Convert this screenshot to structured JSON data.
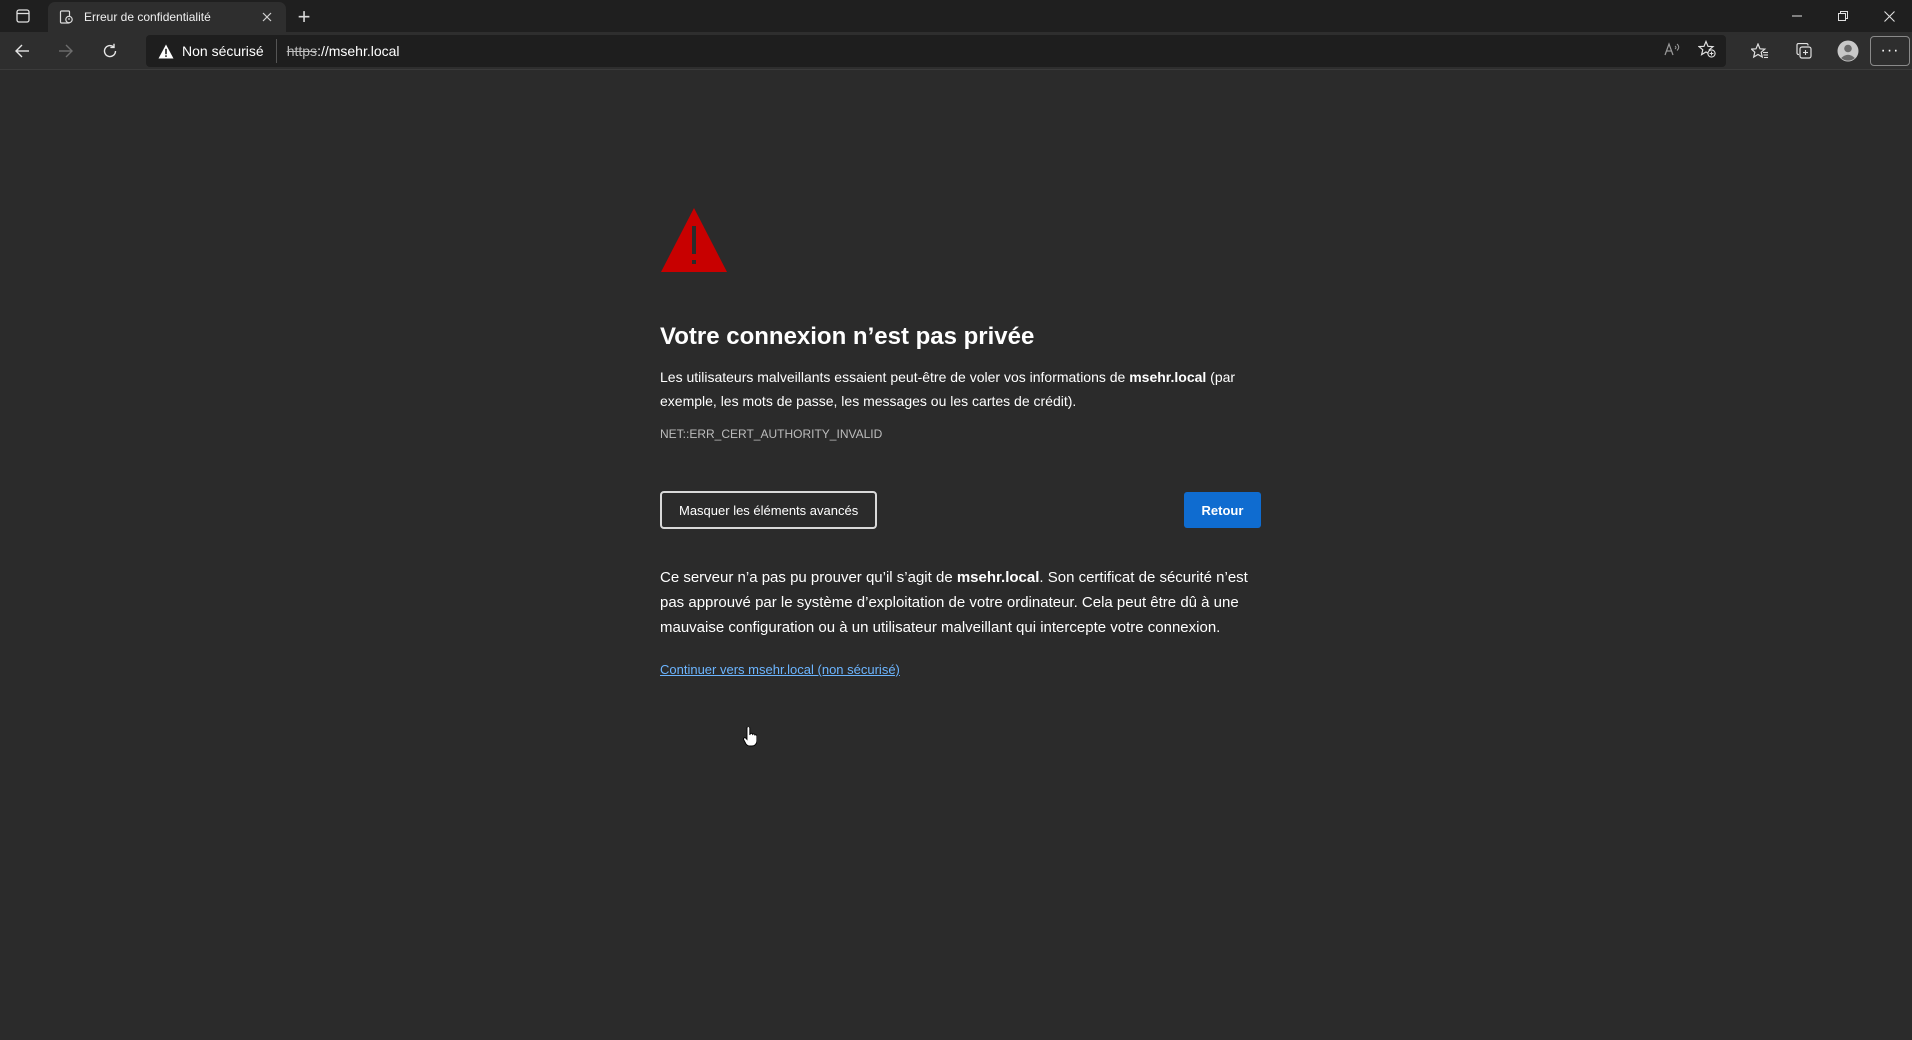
{
  "tab": {
    "title": "Erreur de confidentialité",
    "new_tab_symbol": "+"
  },
  "window_controls": {
    "minimize": "—",
    "restore": "▢",
    "close": "✕"
  },
  "addressbar": {
    "security_label": "Non sécurisé",
    "url_scheme": "https",
    "url_rest": "://msehr.local"
  },
  "toolbar": {
    "more_label": "···"
  },
  "error_page": {
    "heading": "Votre connexion n’est pas privée",
    "desc_before": "Les utilisateurs malveillants essaient peut-être de voler vos informations de ",
    "desc_host": "msehr.local",
    "desc_after": " (par exemple, les mots de passe, les messages ou les cartes de crédit).",
    "error_code": "NET::ERR_CERT_AUTHORITY_INVALID",
    "advanced_button": "Masquer les éléments avancés",
    "back_button": "Retour",
    "details_before": "Ce serveur n’a pas pu prouver qu’il s’agit de ",
    "details_host": "msehr.local",
    "details_after": ". Son certificat de sécurité n’est pas approuvé par le système d’exploitation de votre ordinateur. Cela peut être dû à une mauvaise configuration ou à un utilisateur malveillant qui intercepte votre connexion.",
    "proceed_link": "Continuer vers msehr.local (non sécurisé)"
  },
  "colors": {
    "warning_red": "#c80000",
    "primary_blue": "#0f6cd0",
    "link_blue": "#6cb5ff",
    "page_bg": "#2b2b2b"
  },
  "icons": [
    "tab-actions-icon",
    "page-favicon-icon",
    "close-icon",
    "back-arrow-icon",
    "forward-arrow-icon",
    "refresh-icon",
    "warning-icon",
    "read-aloud-icon",
    "add-favorite-icon",
    "favorites-icon",
    "collections-icon",
    "profile-icon",
    "more-icon"
  ]
}
